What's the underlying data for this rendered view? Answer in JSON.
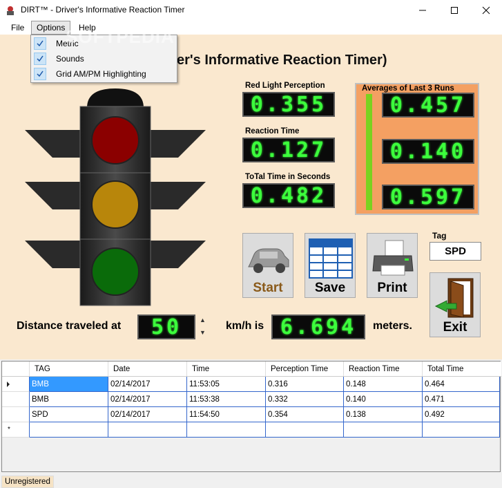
{
  "window": {
    "title": "DIRT™ - Driver's Informative Reaction Timer"
  },
  "menu": {
    "file": "File",
    "options": "Options",
    "help": "Help",
    "options_items": [
      {
        "label": "Metric",
        "checked": true
      },
      {
        "label": "Sounds",
        "checked": true
      },
      {
        "label": "Grid AM/PM Highlighting",
        "checked": true
      }
    ]
  },
  "watermark": "SOFTPEDIA",
  "heading": "er's Informative Reaction Timer)",
  "readouts": {
    "red_light_label": "Red Light Perception",
    "red_light_value": "0.355",
    "reaction_label": "Reaction Time",
    "reaction_value": "0.127",
    "total_label": "ToTal Time in Seconds",
    "total_value": "0.482"
  },
  "averages": {
    "title": "Averages of Last 3 Runs",
    "values": [
      "0.457",
      "0.140",
      "0.597"
    ]
  },
  "buttons": {
    "start": "Start",
    "save": "Save",
    "print": "Print",
    "exit": "Exit"
  },
  "tag": {
    "label": "Tag",
    "value": "SPD"
  },
  "distance": {
    "prefix": "Distance traveled at",
    "speed": "50",
    "unit_label": "km/h is",
    "result": "6.694",
    "suffix": "meters."
  },
  "grid": {
    "columns": [
      "TAG",
      "Date",
      "Time",
      "Perception Time",
      "Reaction Time",
      "Total Time"
    ],
    "rows": [
      [
        "BMB",
        "02/14/2017",
        "11:53:05",
        "0.316",
        "0.148",
        "0.464"
      ],
      [
        "BMB",
        "02/14/2017",
        "11:53:38",
        "0.332",
        "0.140",
        "0.471"
      ],
      [
        "SPD",
        "02/14/2017",
        "11:54:50",
        "0.354",
        "0.138",
        "0.492"
      ]
    ],
    "new_row_marker": "*"
  },
  "status": "Unregistered",
  "colors": {
    "background": "#fae8cf",
    "led_text": "#3cff3c",
    "averages_panel": "#f4a062",
    "red_light": "#8b0000",
    "yellow_light": "#b8860b",
    "green_light": "#0a6b0a"
  }
}
